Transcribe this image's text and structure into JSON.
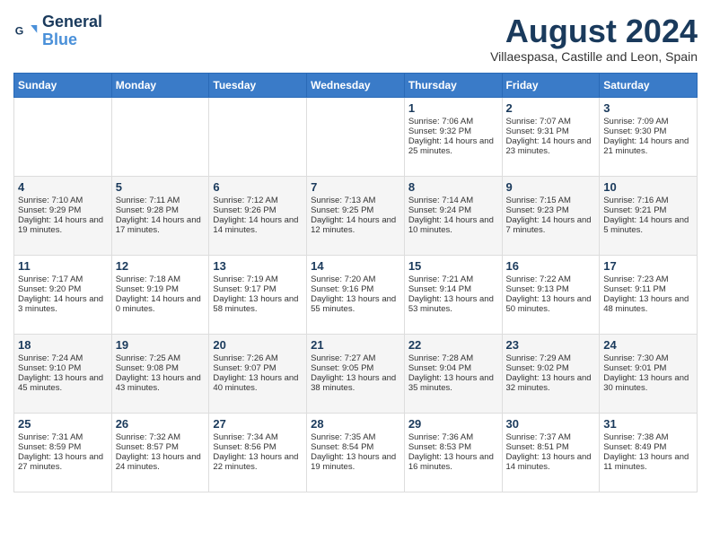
{
  "header": {
    "logo_line1": "General",
    "logo_line2": "Blue",
    "month_year": "August 2024",
    "location": "Villaespasa, Castille and Leon, Spain"
  },
  "days_of_week": [
    "Sunday",
    "Monday",
    "Tuesday",
    "Wednesday",
    "Thursday",
    "Friday",
    "Saturday"
  ],
  "weeks": [
    [
      {
        "day": "",
        "data": ""
      },
      {
        "day": "",
        "data": ""
      },
      {
        "day": "",
        "data": ""
      },
      {
        "day": "",
        "data": ""
      },
      {
        "day": "1",
        "data": "Sunrise: 7:06 AM\nSunset: 9:32 PM\nDaylight: 14 hours and 25 minutes."
      },
      {
        "day": "2",
        "data": "Sunrise: 7:07 AM\nSunset: 9:31 PM\nDaylight: 14 hours and 23 minutes."
      },
      {
        "day": "3",
        "data": "Sunrise: 7:09 AM\nSunset: 9:30 PM\nDaylight: 14 hours and 21 minutes."
      }
    ],
    [
      {
        "day": "4",
        "data": "Sunrise: 7:10 AM\nSunset: 9:29 PM\nDaylight: 14 hours and 19 minutes."
      },
      {
        "day": "5",
        "data": "Sunrise: 7:11 AM\nSunset: 9:28 PM\nDaylight: 14 hours and 17 minutes."
      },
      {
        "day": "6",
        "data": "Sunrise: 7:12 AM\nSunset: 9:26 PM\nDaylight: 14 hours and 14 minutes."
      },
      {
        "day": "7",
        "data": "Sunrise: 7:13 AM\nSunset: 9:25 PM\nDaylight: 14 hours and 12 minutes."
      },
      {
        "day": "8",
        "data": "Sunrise: 7:14 AM\nSunset: 9:24 PM\nDaylight: 14 hours and 10 minutes."
      },
      {
        "day": "9",
        "data": "Sunrise: 7:15 AM\nSunset: 9:23 PM\nDaylight: 14 hours and 7 minutes."
      },
      {
        "day": "10",
        "data": "Sunrise: 7:16 AM\nSunset: 9:21 PM\nDaylight: 14 hours and 5 minutes."
      }
    ],
    [
      {
        "day": "11",
        "data": "Sunrise: 7:17 AM\nSunset: 9:20 PM\nDaylight: 14 hours and 3 minutes."
      },
      {
        "day": "12",
        "data": "Sunrise: 7:18 AM\nSunset: 9:19 PM\nDaylight: 14 hours and 0 minutes."
      },
      {
        "day": "13",
        "data": "Sunrise: 7:19 AM\nSunset: 9:17 PM\nDaylight: 13 hours and 58 minutes."
      },
      {
        "day": "14",
        "data": "Sunrise: 7:20 AM\nSunset: 9:16 PM\nDaylight: 13 hours and 55 minutes."
      },
      {
        "day": "15",
        "data": "Sunrise: 7:21 AM\nSunset: 9:14 PM\nDaylight: 13 hours and 53 minutes."
      },
      {
        "day": "16",
        "data": "Sunrise: 7:22 AM\nSunset: 9:13 PM\nDaylight: 13 hours and 50 minutes."
      },
      {
        "day": "17",
        "data": "Sunrise: 7:23 AM\nSunset: 9:11 PM\nDaylight: 13 hours and 48 minutes."
      }
    ],
    [
      {
        "day": "18",
        "data": "Sunrise: 7:24 AM\nSunset: 9:10 PM\nDaylight: 13 hours and 45 minutes."
      },
      {
        "day": "19",
        "data": "Sunrise: 7:25 AM\nSunset: 9:08 PM\nDaylight: 13 hours and 43 minutes."
      },
      {
        "day": "20",
        "data": "Sunrise: 7:26 AM\nSunset: 9:07 PM\nDaylight: 13 hours and 40 minutes."
      },
      {
        "day": "21",
        "data": "Sunrise: 7:27 AM\nSunset: 9:05 PM\nDaylight: 13 hours and 38 minutes."
      },
      {
        "day": "22",
        "data": "Sunrise: 7:28 AM\nSunset: 9:04 PM\nDaylight: 13 hours and 35 minutes."
      },
      {
        "day": "23",
        "data": "Sunrise: 7:29 AM\nSunset: 9:02 PM\nDaylight: 13 hours and 32 minutes."
      },
      {
        "day": "24",
        "data": "Sunrise: 7:30 AM\nSunset: 9:01 PM\nDaylight: 13 hours and 30 minutes."
      }
    ],
    [
      {
        "day": "25",
        "data": "Sunrise: 7:31 AM\nSunset: 8:59 PM\nDaylight: 13 hours and 27 minutes."
      },
      {
        "day": "26",
        "data": "Sunrise: 7:32 AM\nSunset: 8:57 PM\nDaylight: 13 hours and 24 minutes."
      },
      {
        "day": "27",
        "data": "Sunrise: 7:34 AM\nSunset: 8:56 PM\nDaylight: 13 hours and 22 minutes."
      },
      {
        "day": "28",
        "data": "Sunrise: 7:35 AM\nSunset: 8:54 PM\nDaylight: 13 hours and 19 minutes."
      },
      {
        "day": "29",
        "data": "Sunrise: 7:36 AM\nSunset: 8:53 PM\nDaylight: 13 hours and 16 minutes."
      },
      {
        "day": "30",
        "data": "Sunrise: 7:37 AM\nSunset: 8:51 PM\nDaylight: 13 hours and 14 minutes."
      },
      {
        "day": "31",
        "data": "Sunrise: 7:38 AM\nSunset: 8:49 PM\nDaylight: 13 hours and 11 minutes."
      }
    ]
  ]
}
